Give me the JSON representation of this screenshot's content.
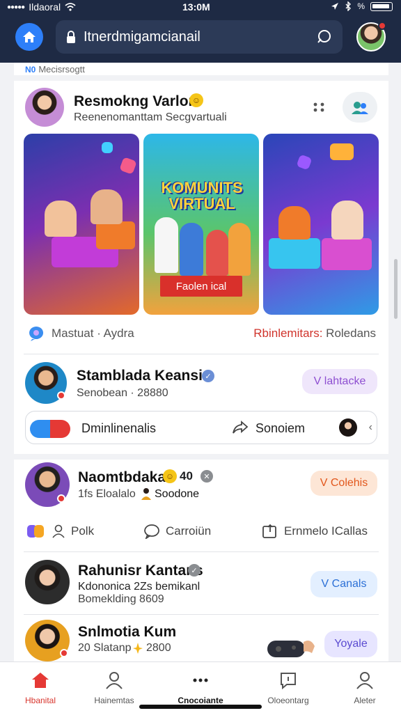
{
  "status_bar": {
    "carrier": "Ildaoral",
    "time": "13:0M"
  },
  "browser": {
    "url": "Itnerdmigamcianail"
  },
  "feed": {
    "section_label": "Mecisrsogtt",
    "section_tag": "N0",
    "post1": {
      "author": "Resmokng Varlore",
      "subtitle": "Reenenomanttam Secgvartuali",
      "image_title": "KOMUNITS VIRTUAL",
      "image_caption": "Faolen ical",
      "meta_left": "Mastuat · Aydra",
      "meta_right_highlight": "Rbinlemitars:",
      "meta_right": " Roledans"
    },
    "post2": {
      "author": "Stamblada Keansio",
      "subtitle": "Senobean · 28880",
      "button": "V lahtacke",
      "shared_label": "Dminlinenalis",
      "shared_action": "Sonoiem"
    },
    "post3": {
      "author": "Naomtbdakar",
      "badge_count": "40",
      "subtitle_left": "1fs Eloalalo",
      "subtitle_right": "Soodone",
      "button": "V Colehis",
      "actions": {
        "like": "Polk",
        "comment": "Carroiün",
        "share": "Ernmelo ICallas"
      }
    },
    "post4": {
      "author": "Rahunisr Kantans",
      "line1": "Kdononica 2Zs bemikanl",
      "line2": "Bomeklding 8609",
      "button": "V Canals"
    },
    "post5": {
      "author": "Snlmotia Kum",
      "subtitle": "20 Slatanp",
      "subtitle_num": "2800",
      "button": "Yoyale"
    }
  },
  "bottom_nav": {
    "items": [
      {
        "label": "Hbanital",
        "icon": "home-icon",
        "active": true
      },
      {
        "label": "Hainemtas",
        "icon": "person-icon",
        "active": false
      },
      {
        "label": "Cnocoiante",
        "icon": "more-icon",
        "active": false
      },
      {
        "label": "Oloeontarg",
        "icon": "chat-icon",
        "active": false
      },
      {
        "label": "Aleter",
        "icon": "profile-icon",
        "active": false
      }
    ]
  },
  "colors": {
    "header": "#1e2a44",
    "accent_blue": "#2d7ff9",
    "accent_red": "#d8342c"
  }
}
